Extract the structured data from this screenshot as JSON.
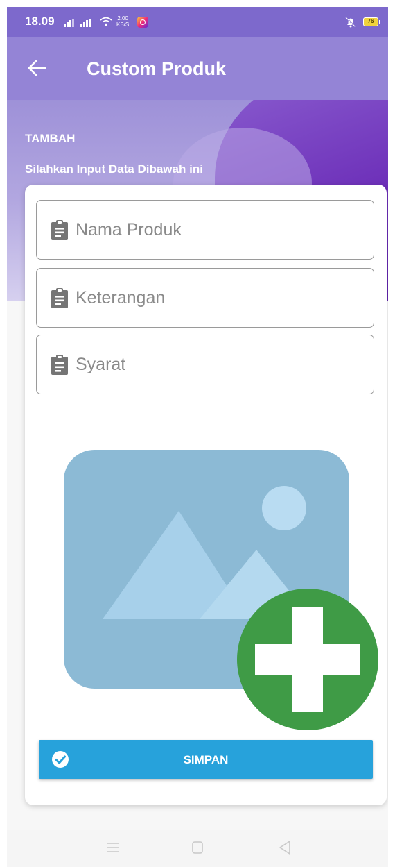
{
  "status_bar": {
    "time": "18.09",
    "net_speed_value": "2.00",
    "net_speed_unit": "KB/S",
    "battery": "76",
    "icons": [
      "signal-icon",
      "signal-icon",
      "wifi-icon",
      "instagram-icon",
      "mute-icon",
      "battery-icon"
    ]
  },
  "app_bar": {
    "title": "Custom Produk",
    "back_icon": "arrow-left-icon"
  },
  "header": {
    "label": "TAMBAH",
    "subtitle": "Silahkan Input Data Dibawah ini"
  },
  "form": {
    "fields": [
      {
        "placeholder": "Nama Produk",
        "value": "",
        "icon": "clipboard-icon"
      },
      {
        "placeholder": "Keterangan",
        "value": "",
        "icon": "clipboard-icon"
      },
      {
        "placeholder": "Syarat",
        "value": "",
        "icon": "clipboard-icon"
      }
    ],
    "image_picker_icon": "image-add-icon",
    "save_label": "SIMPAN",
    "save_icon": "check-circle-icon"
  },
  "nav_bar": {
    "icons": [
      "menu-icon",
      "home-square-icon",
      "back-triangle-icon"
    ]
  },
  "colors": {
    "status_bar": "#7d69cc",
    "app_bar": "#9484d6",
    "header_accent": "#6c2eb8",
    "save_button": "#27a2db",
    "add_badge": "#3f9b46",
    "image_placeholder": "#8cbad5"
  }
}
